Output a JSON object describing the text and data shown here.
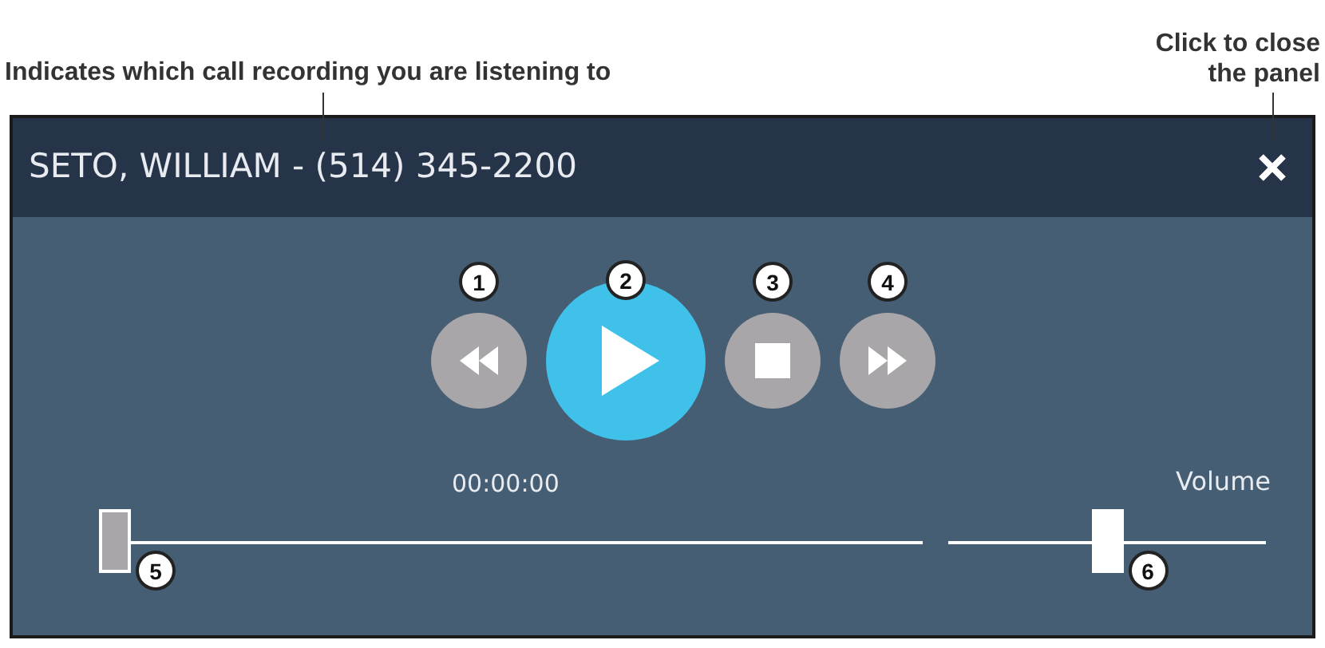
{
  "annotations": [
    {
      "text": "Indicates which call recording you are listening to"
    },
    {
      "text": "Click to close the panel"
    }
  ],
  "panel": {
    "title": "SETO, WILLIAM - (514) 345-2200",
    "controls": [
      {
        "kind": "rewind",
        "callout": "1"
      },
      {
        "kind": "play",
        "callout": "2"
      },
      {
        "kind": "stop",
        "callout": "3"
      },
      {
        "kind": "forward",
        "callout": "4"
      }
    ],
    "time": "00:00:00",
    "progress": {
      "level": 0,
      "callout": "5"
    },
    "volume": {
      "label": "Volume",
      "level": 0.5,
      "callout": "6"
    }
  }
}
